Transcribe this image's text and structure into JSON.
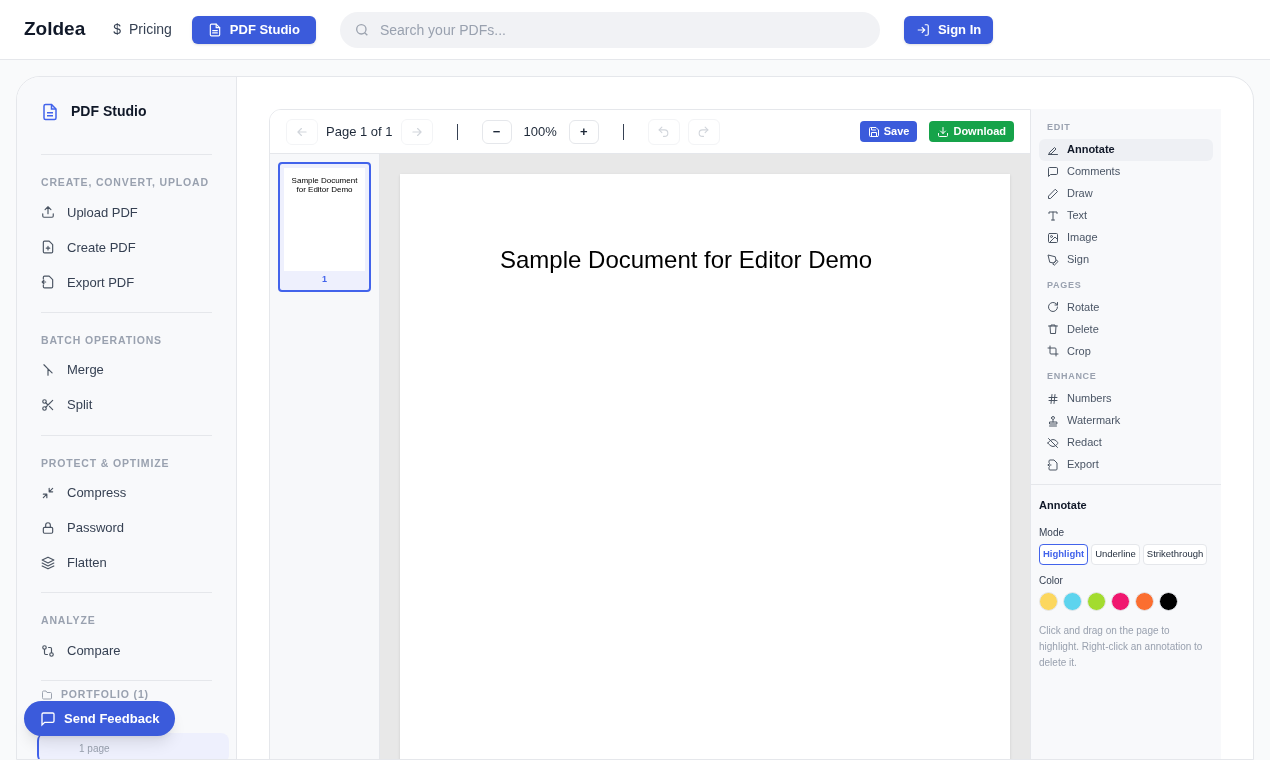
{
  "header": {
    "logo": "Zoldea",
    "nav": [
      {
        "label": "Pricing",
        "icon_char": "$",
        "selected": false
      },
      {
        "label": "PDF Studio",
        "selected": true
      }
    ],
    "search": {
      "placeholder": "Search your PDFs..."
    },
    "sign_in": "Sign In"
  },
  "sidebar": {
    "title": "PDF Studio",
    "sections": [
      {
        "heading": "CREATE, CONVERT, UPLOAD",
        "items": [
          "Upload PDF",
          "Create PDF",
          "Export PDF"
        ]
      },
      {
        "heading": "BATCH OPERATIONS",
        "items": [
          "Merge",
          "Split"
        ]
      },
      {
        "heading": "PROTECT & OPTIMIZE",
        "items": [
          "Compress",
          "Password",
          "Flatten"
        ]
      },
      {
        "heading": "ANALYZE",
        "items": [
          "Compare"
        ]
      }
    ],
    "portfolio": {
      "heading": "PORTFOLIO (1)",
      "files": [
        {
          "meta": "1 page",
          "selected": true
        }
      ]
    }
  },
  "feedback_button": "Send Feedback",
  "toolbar": {
    "page": "Page 1 of 1",
    "zoom_out": "−",
    "zoom": "100%",
    "zoom_in": "+",
    "save": "Save",
    "download": "Download"
  },
  "thumbnails": [
    {
      "number": "1",
      "text": "Sample Document for Editor Demo",
      "selected": true
    }
  ],
  "document": {
    "heading": "Sample Document for Editor Demo"
  },
  "tools": {
    "sections": [
      {
        "heading": "EDIT",
        "items": [
          {
            "label": "Annotate",
            "selected": true
          },
          {
            "label": "Comments",
            "selected": false
          },
          {
            "label": "Draw",
            "selected": false
          },
          {
            "label": "Text",
            "selected": false
          },
          {
            "label": "Image",
            "selected": false
          },
          {
            "label": "Sign",
            "selected": false
          }
        ]
      },
      {
        "heading": "PAGES",
        "items": [
          {
            "label": "Rotate",
            "selected": false
          },
          {
            "label": "Delete",
            "selected": false
          },
          {
            "label": "Crop",
            "selected": false
          }
        ]
      },
      {
        "heading": "ENHANCE",
        "items": [
          {
            "label": "Numbers",
            "selected": false
          },
          {
            "label": "Watermark",
            "selected": false
          },
          {
            "label": "Redact",
            "selected": false
          },
          {
            "label": "Export",
            "selected": false
          }
        ]
      }
    ]
  },
  "annotate": {
    "title": "Annotate",
    "mode_label": "Mode",
    "modes": [
      {
        "label": "Highlight",
        "selected": true
      },
      {
        "label": "Underline",
        "selected": false
      },
      {
        "label": "Strikethrough",
        "selected": false
      }
    ],
    "color_label": "Color",
    "colors": [
      {
        "color": "#fcd75e"
      },
      {
        "color": "#5dd4ee"
      },
      {
        "color": "#a3dc2f"
      },
      {
        "color": "#f0176f"
      },
      {
        "color": "#fb6e30"
      },
      {
        "color": "#000000"
      }
    ],
    "hint": "Click and drag on the page to highlight. Right-click an annotation to delete it."
  }
}
